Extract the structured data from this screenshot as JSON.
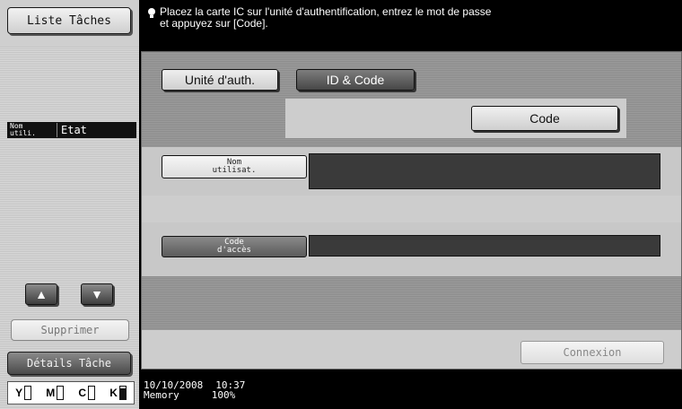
{
  "left": {
    "job_list_label": "Liste Tâches",
    "list_header": {
      "col1": "Nom\nutili.",
      "col2": "Etat"
    },
    "delete_label": "Supprimer",
    "details_label": "Détails Tâche"
  },
  "toner": [
    {
      "letter": "Y",
      "level": 0.0
    },
    {
      "letter": "M",
      "level": 0.0
    },
    {
      "letter": "C",
      "level": 0.0
    },
    {
      "letter": "K",
      "level": 0.85
    }
  ],
  "message": {
    "text": "Placez la carte IC sur l'unité d'authentification, entrez le mot de passe\net appuyez sur [Code]."
  },
  "tabs": {
    "auth_unit": "Unité d'auth.",
    "id_code": "ID & Code"
  },
  "code_button": "Code",
  "fields": {
    "username_label": "Nom\nutilisat.",
    "password_label": "Code\nd'accès"
  },
  "login_button": "Connexion",
  "status": {
    "date": "10/10/2008",
    "time": "10:37",
    "memory_label": "Memory",
    "memory_value": "100%"
  }
}
